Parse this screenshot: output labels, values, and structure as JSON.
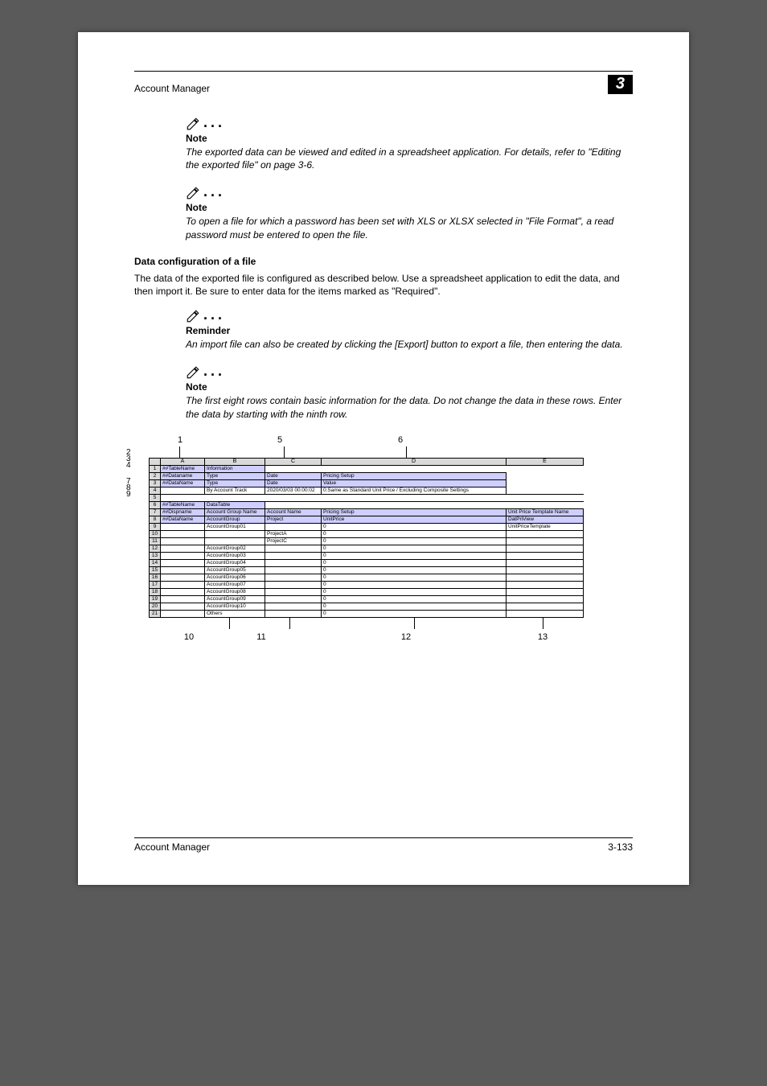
{
  "header": {
    "running_title": "Account Manager",
    "chapter_number": "3"
  },
  "notes": {
    "note1": {
      "label": "Note",
      "body": "The exported data can be viewed and edited in a spreadsheet application. For details, refer to \"Editing the exported file\" on page 3-6."
    },
    "note2": {
      "label": "Note",
      "body": "To open a file for which a password has been set with XLS or XLSX selected in \"File Format\", a read password must be entered to open the file."
    },
    "reminder": {
      "label": "Reminder",
      "body": "An import file can also be created by clicking the [Export] button to export a file, then entering the data."
    },
    "note3": {
      "label": "Note",
      "body": "The first eight rows contain basic information for the data. Do not change the data in these rows. Enter the data by starting with the ninth row."
    }
  },
  "section": {
    "heading": "Data configuration of a file",
    "paragraph": "The data of the exported file is configured as described below. Use a spreadsheet application to edit the data, and then import it. Be sure to enter data for the items marked as \"Required\"."
  },
  "figure": {
    "callouts_top": {
      "c1": "1",
      "c5": "5",
      "c6": "6"
    },
    "callouts_left": [
      "2",
      "3",
      "4",
      "",
      "",
      "7",
      "8",
      "9"
    ],
    "callouts_bottom": {
      "c10": "10",
      "c11": "11",
      "c12": "12",
      "c13": "13"
    },
    "columns": [
      "A",
      "B",
      "C",
      "D",
      "E"
    ],
    "row1": {
      "a": "##TableName",
      "b": "Information"
    },
    "row2": {
      "a": "##Dataname",
      "b": "Type",
      "c": "Date",
      "d": "Pricing Setup"
    },
    "row3": {
      "a": "##DataName",
      "b": "Type",
      "c": "Date",
      "d": "Value"
    },
    "row4": {
      "b": "By Account Track",
      "c": "2020/03/03 00:00:02",
      "d": "0:Same as Standard Unit Price / Excluding Composite Settings"
    },
    "row6": {
      "a": "##TableName",
      "b": "DataTable"
    },
    "row7": {
      "a": "##Dispname",
      "b": "Account Group Name",
      "c": "Account Name",
      "d": "Pricing Setup",
      "e": "Unit Price Template Name"
    },
    "row8": {
      "a": "##DataName",
      "b": "AccountGroup",
      "c": "Project",
      "d": "UnitPrice",
      "e": "DatPriView"
    },
    "row9": {
      "b": "AccountGroup01",
      "d": "0",
      "e": "UnitPriceTemplate"
    },
    "row10": {
      "c": "ProjectA",
      "d": "0"
    },
    "row11": {
      "c": "ProjectC",
      "d": "0"
    },
    "dataRows": [
      {
        "b": "AccountGroup02",
        "d": "0"
      },
      {
        "b": "AccountGroup03",
        "d": "0"
      },
      {
        "b": "AccountGroup04",
        "d": "0"
      },
      {
        "b": "AccountGroup05",
        "d": "0"
      },
      {
        "b": "AccountGroup06",
        "d": "0"
      },
      {
        "b": "AccountGroup07",
        "d": "0"
      },
      {
        "b": "AccountGroup08",
        "d": "0"
      },
      {
        "b": "AccountGroup09",
        "d": "0"
      },
      {
        "b": "AccountGroup10",
        "d": "0"
      },
      {
        "b": "Others",
        "d": "0"
      }
    ]
  },
  "footer": {
    "left": "Account Manager",
    "right": "3-133"
  }
}
